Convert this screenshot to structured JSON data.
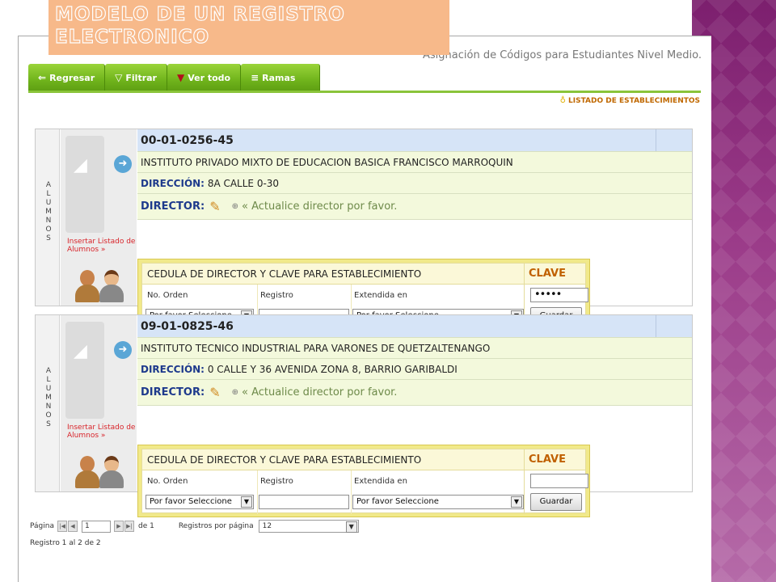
{
  "slide": {
    "title_line1": "MODELO DE UN REGISTRO",
    "title_line2": "ELECTRONICO"
  },
  "app": {
    "page_caption": "Asignación de Códigos para Estudiantes Nivel Medio.",
    "listado": "LISTADO DE ESTABLECIMIENTOS"
  },
  "toolbar": {
    "back": "Regresar",
    "filter": "Filtrar",
    "view_all": "Ver todo",
    "branches": "Ramas"
  },
  "icons": {
    "back": "arrow-left-icon",
    "filter": "funnel-icon",
    "view_all": "funnel-x-icon",
    "branches": "list-icon",
    "bulb": "lightbulb-icon",
    "pencil": "pencil-icon"
  },
  "records": [
    {
      "side_label": "A L U M N O S",
      "code": "00-01-0256-45",
      "name": "INSTITUTO PRIVADO MIXTO DE EDUCACION BASICA FRANCISCO MARROQUIN",
      "address_label": "DIRECCIÓN:",
      "address": "8A CALLE 0-30",
      "director_label": "DIRECTOR:",
      "director_msg": "« Actualice director por favor.",
      "insert_link": "Insertar Listado de Alumnos »",
      "clave_title": "CEDULA DE DIRECTOR Y CLAVE PARA ESTABLECIMIENTO",
      "clave_label": "CLAVE",
      "col_orden": "No. Orden",
      "col_registro": "Registro",
      "col_extendida": "Extendida en",
      "password": "•••••",
      "select_orden": "Por favor Seleccione",
      "registro_value": "",
      "select_extendida": "Por favor Seleccione",
      "save": "Guardar"
    },
    {
      "side_label": "A L U M N O S",
      "code": "09-01-0825-46",
      "name": "INSTITUTO TECNICO INDUSTRIAL PARA VARONES DE QUETZALTENANGO",
      "address_label": "DIRECCIÓN:",
      "address": "0 CALLE Y 36 AVENIDA ZONA 8, BARRIO GARIBALDI",
      "director_label": "DIRECTOR:",
      "director_msg": "« Actualice director por favor.",
      "insert_link": "Insertar Listado de Alumnos »",
      "clave_title": "CEDULA DE DIRECTOR Y CLAVE PARA ESTABLECIMIENTO",
      "clave_label": "CLAVE",
      "col_orden": "No. Orden",
      "col_registro": "Registro",
      "col_extendida": "Extendida en",
      "password": "",
      "select_orden": "Por favor Seleccione",
      "registro_value": "",
      "select_extendida": "Por favor Seleccione",
      "save": "Guardar"
    }
  ],
  "pager": {
    "page_label": "Página",
    "page_value": "1",
    "of_label": "de 1",
    "per_page_label": "Registros por página",
    "per_page_value": "12",
    "record_info": "Registro 1 al 2 de 2"
  },
  "colors": {
    "toolbar_green": "#70b41c",
    "accent_orange": "#c06000",
    "title_bg": "#f7b98a",
    "deco_purple": "#8a2a78"
  }
}
